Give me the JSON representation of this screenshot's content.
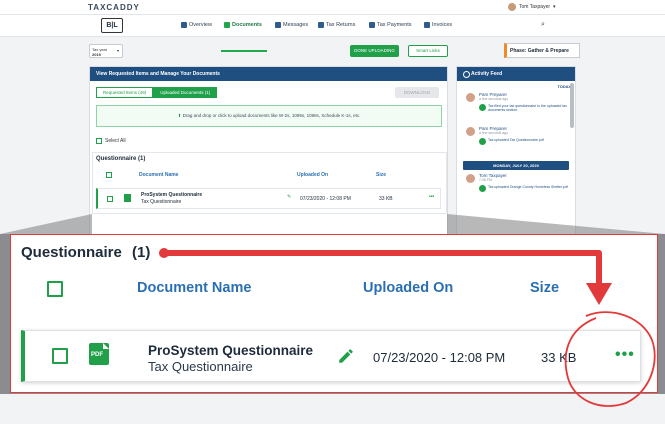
{
  "app": {
    "logo": "TAXCADDY",
    "org_badge": "B|L",
    "user_name": "Tom Taxpayer",
    "nav": [
      {
        "label": "Overview"
      },
      {
        "label": "Documents"
      },
      {
        "label": "Messages"
      },
      {
        "label": "Tax Returns"
      },
      {
        "label": "Tax Payments"
      },
      {
        "label": "Invoices"
      }
    ],
    "tax_year_label": "Tax year",
    "tax_year_value": "2019",
    "done_button": "DONE UPLOADING",
    "smart_links_button": "Smart Links",
    "phase": "Phase: Gather & Prepare",
    "docs_header": "View Requested Items and Manage Your Documents",
    "tabs": {
      "requested": "Requested Items (49)",
      "uploaded": "Uploaded Documents (1)"
    },
    "download_button": "DOWNLOAD",
    "dropzone_text": "Drag and drop or click to upload documents like W-2s, 1099s, 1098s, Schedule K-1s, etc.",
    "select_all": "Select All"
  },
  "feed": {
    "title": "Activity Feed",
    "day_today": "TODAY",
    "day_other": "MONDAY, JULY 20, 2020",
    "entries": [
      {
        "name": "Pam Preparer",
        "time": "a few seconds ago",
        "action": "Tax filed your tax questionnaire to the uploaded tax documents section."
      },
      {
        "name": "Pam Preparer",
        "time": "a few seconds ago",
        "action": "Tax uploaded Tax Questionnaire.pdf"
      },
      {
        "name": "Tom Taxpayer",
        "time": "7:38 PM",
        "action": "Tax uploaded Orange County Homeless Shelter.pdf"
      }
    ]
  },
  "questionnaire": {
    "title": "Questionnaire",
    "count": "(1)",
    "columns": {
      "name": "Document Name",
      "uploaded": "Uploaded On",
      "size": "Size"
    },
    "rows": [
      {
        "icon_label": "PDF",
        "name": "ProSystem Questionnaire",
        "type": "Tax Questionnaire",
        "uploaded_on": "07/23/2020 - 12:08 PM",
        "size": "33 KB",
        "more": "•••"
      }
    ]
  },
  "colors": {
    "accent_green": "#21a04a",
    "header_blue": "#1f4e80",
    "annotation_red": "#e23a3a",
    "column_blue": "#2a6fb3"
  }
}
